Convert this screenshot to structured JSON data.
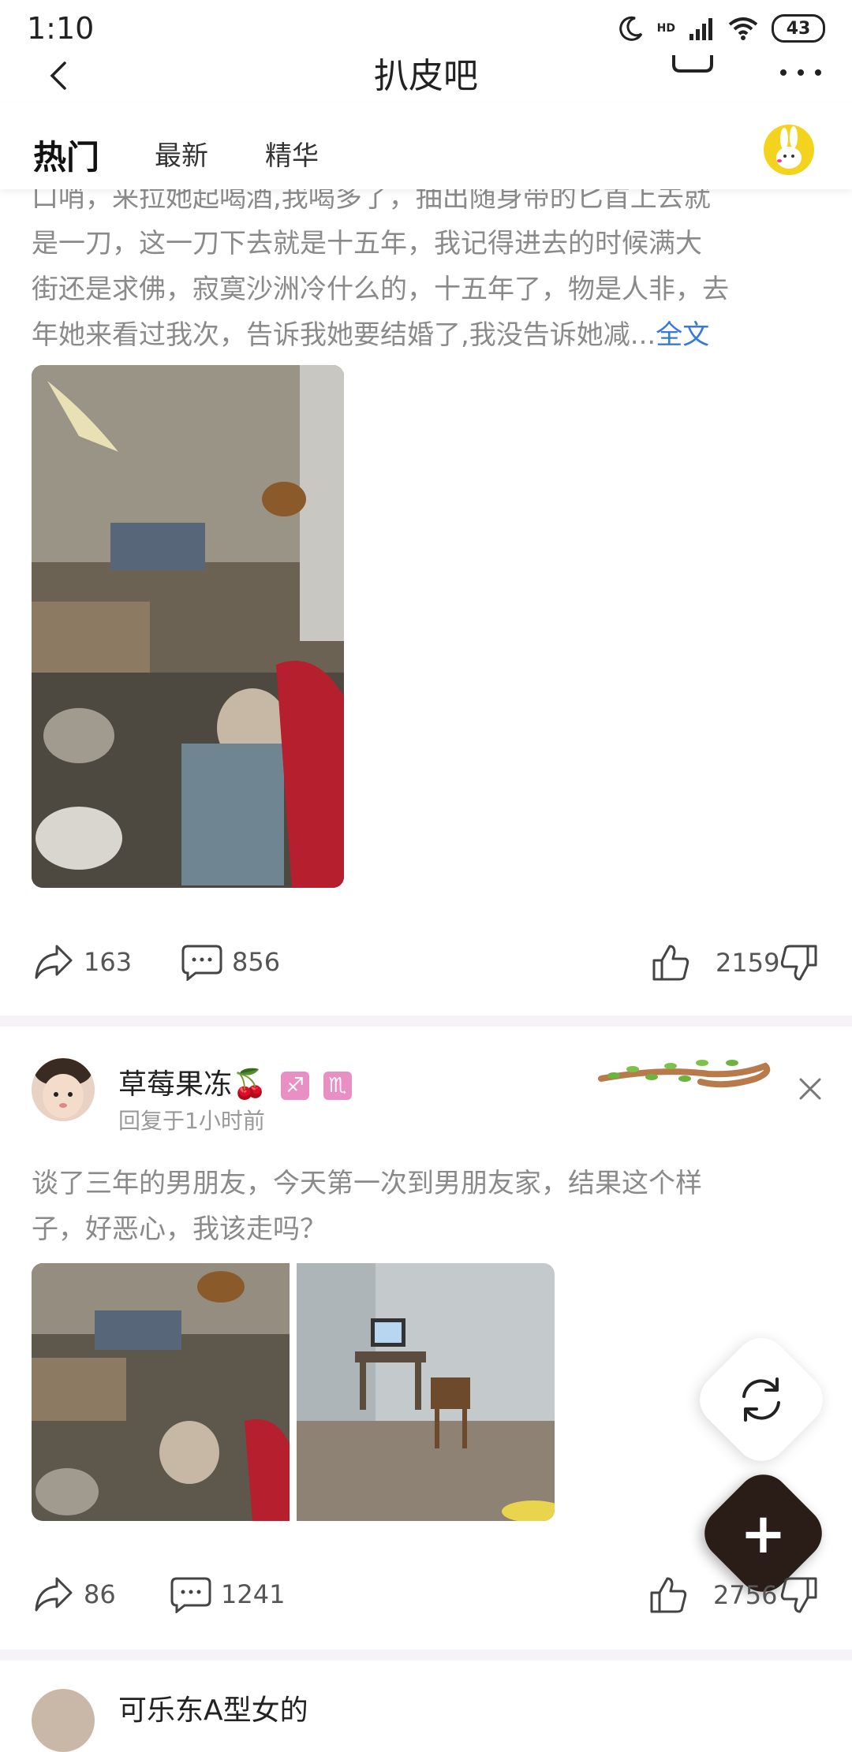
{
  "status_bar": {
    "time": "1:10",
    "battery": "43",
    "hd_label": "HD"
  },
  "title_bar": {
    "title": "扒皮吧"
  },
  "tabs": [
    {
      "label": "热门",
      "active": true
    },
    {
      "label": "最新",
      "active": false
    },
    {
      "label": "精华",
      "active": false
    }
  ],
  "post1": {
    "text_lines": [
      "口哨，来拉她起喝酒,我喝多了，抽出随身带的匕首上去就",
      "是一刀，这一刀下去就是十五年，我记得进去的时候满大",
      "街还是求佛，寂寞沙洲冷什么的，十五年了，物是人非，去",
      "年她来看过我次，告诉我她要结婚了,我没告诉她减..."
    ],
    "full_text_link": "全文",
    "shares": "163",
    "comments": "856",
    "likes": "2159"
  },
  "post2": {
    "username": "草莓果冻🍒",
    "badges": [
      "♐",
      "♏"
    ],
    "reply_time": "回复于1小时前",
    "text_lines": [
      "谈了三年的男朋友，今天第一次到男朋友家，结果这个样",
      "子，好恶心，我该走吗？"
    ],
    "shares": "86",
    "comments": "1241",
    "likes": "2756"
  },
  "next_post": {
    "username": "可乐东A型女的"
  },
  "colors": {
    "link": "#3478e0",
    "fab_dark": "#2a1d17",
    "badge": "#e88fc4",
    "divider": "#f5f3f7"
  }
}
